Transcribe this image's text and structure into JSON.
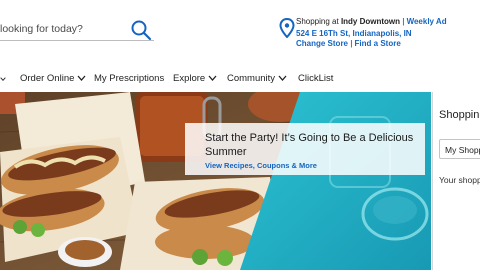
{
  "header": {
    "search": {
      "placeholder_text": "looking for today?"
    },
    "store": {
      "prefix": "Shopping at ",
      "name": "Indy Downtown",
      "separator": " | ",
      "weekly_ad": "Weekly Ad",
      "address": "524 E 16Th St, Indianapolis, IN",
      "change_store": "Change Store",
      "sep2": " | ",
      "find_store": "Find a Store"
    }
  },
  "nav": {
    "items": [
      {
        "label": "Order Online",
        "has_dropdown": true
      },
      {
        "label": "My Prescriptions",
        "has_dropdown": false
      },
      {
        "label": "Explore",
        "has_dropdown": true
      },
      {
        "label": "Community",
        "has_dropdown": true
      },
      {
        "label": "ClickList",
        "has_dropdown": false
      }
    ]
  },
  "hero": {
    "title": "Start the Party! It’s Going to Be a Delicious Summer",
    "link": "View Recipes, Coupons & More"
  },
  "panel": {
    "title": "Shoppin",
    "select": "My Shopp",
    "text": "Your shopp"
  },
  "colors": {
    "link_blue": "#1565c0",
    "accent_teal": "#1fb6c8"
  }
}
